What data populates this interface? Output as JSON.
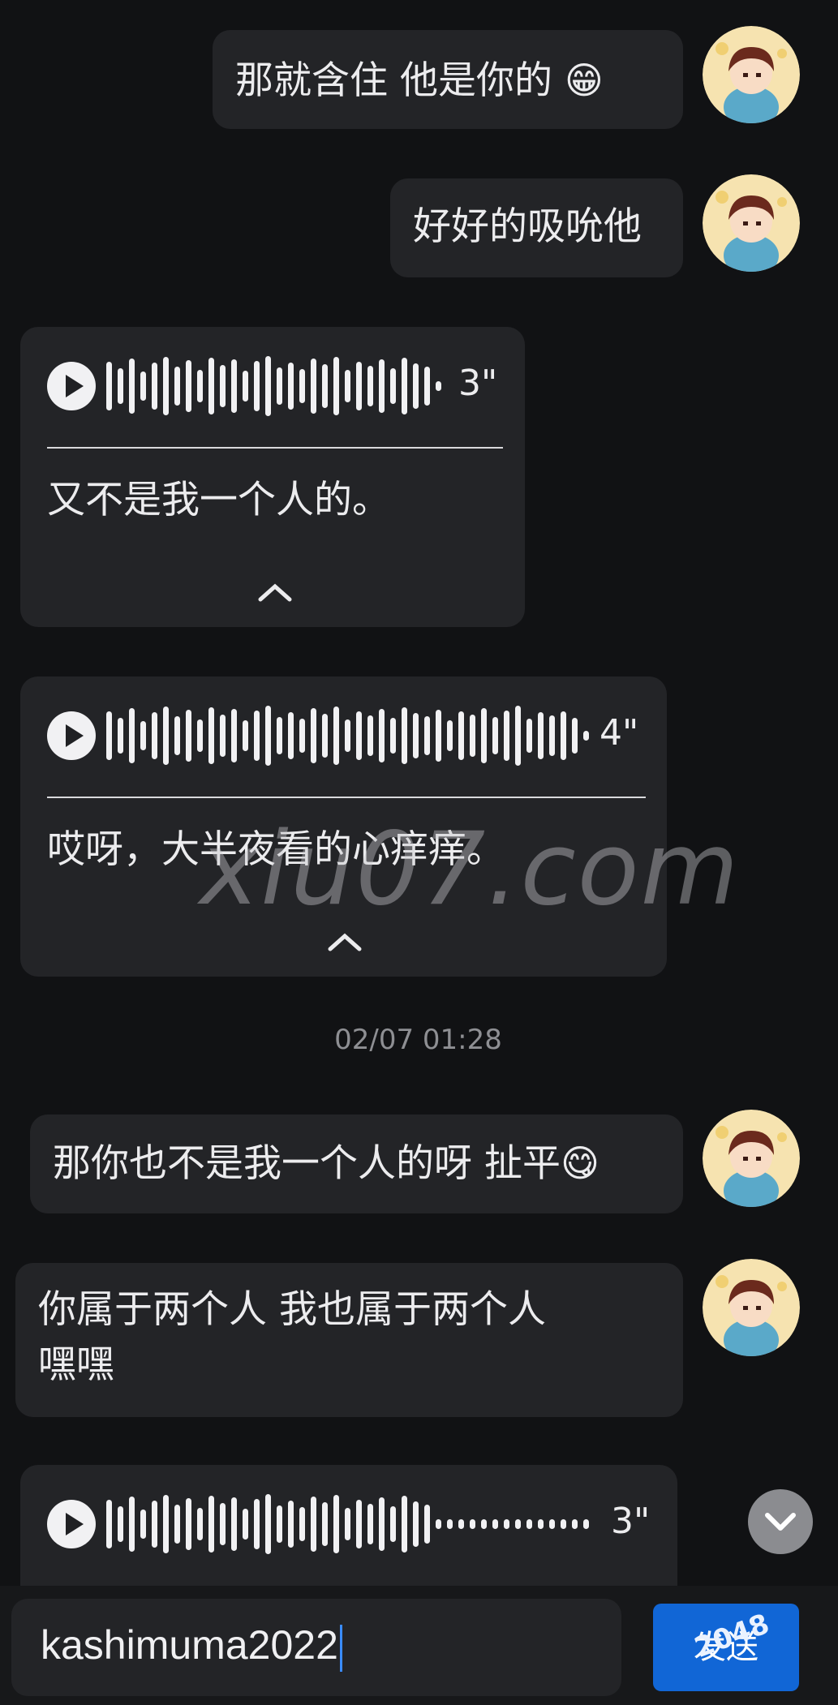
{
  "messages": [
    {
      "id": "m1",
      "type": "text",
      "side": "right",
      "text": "那就含住  他是你的",
      "emoji": "😁"
    },
    {
      "id": "m2",
      "type": "text",
      "side": "right",
      "text": "好好的吸吮他"
    },
    {
      "id": "m3",
      "type": "voice",
      "side": "left",
      "duration": "3\"",
      "transcript": "又不是我一个人的。"
    },
    {
      "id": "m4",
      "type": "voice",
      "side": "left",
      "duration": "4\"",
      "transcript": "哎呀，大半夜看的心痒痒。"
    },
    {
      "id": "m5",
      "type": "text",
      "side": "right",
      "text": "那你也不是我一个人的呀  扯平",
      "emoji": "😋"
    },
    {
      "id": "m6",
      "type": "text",
      "side": "right",
      "lines": [
        "你属于两个人  我也属于两个人",
        "嘿嘿"
      ]
    },
    {
      "id": "m7",
      "type": "voice",
      "side": "left",
      "duration": "3\""
    }
  ],
  "timestamp": "02/07 01:28",
  "watermark": "xiu07.com",
  "input": {
    "value": "kashimuma2022"
  },
  "send_button": {
    "label": "发送",
    "overlay": "2048"
  },
  "colors": {
    "background": "#111214",
    "bubble": "#232427",
    "send": "#1166d6"
  }
}
